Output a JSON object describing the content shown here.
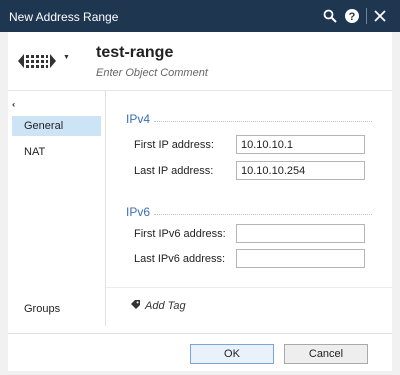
{
  "window": {
    "title": "New Address Range",
    "search_icon": "search-icon",
    "help_icon": "help-icon",
    "close_icon": "close-icon"
  },
  "object": {
    "name": "test-range",
    "comment_placeholder": "Enter Object Comment",
    "icon": "address-range-icon"
  },
  "sidebar": {
    "collapse_glyph": "‹‹",
    "items": [
      {
        "label": "General",
        "active": true
      },
      {
        "label": "NAT",
        "active": false
      }
    ],
    "bottom_item": "Groups"
  },
  "ipv4": {
    "title": "IPv4",
    "first_label": "First IP address:",
    "first_value": "10.10.10.1",
    "last_label": "Last IP address:",
    "last_value": "10.10.10.254"
  },
  "ipv6": {
    "title": "IPv6",
    "first_label": "First IPv6 address:",
    "first_value": "",
    "last_label": "Last IPv6 address:",
    "last_value": ""
  },
  "tags": {
    "add_label": "Add Tag",
    "icon": "tag-icon"
  },
  "footer": {
    "ok_label": "OK",
    "cancel_label": "Cancel"
  },
  "colors": {
    "titlebar": "#1f3651",
    "section_title": "#3b6fb6",
    "active_nav": "#cde4f7"
  }
}
